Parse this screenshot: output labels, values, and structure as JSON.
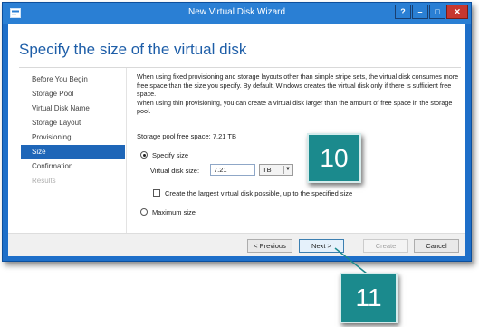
{
  "window": {
    "title": "New Virtual Disk Wizard",
    "controls": {
      "help": "?",
      "minimize": "–",
      "maximize": "□",
      "close": "✕"
    }
  },
  "page_title": "Specify the size of the virtual disk",
  "nav": {
    "items": [
      {
        "label": "Before You Begin",
        "state": "normal"
      },
      {
        "label": "Storage Pool",
        "state": "normal"
      },
      {
        "label": "Virtual Disk Name",
        "state": "normal"
      },
      {
        "label": "Storage Layout",
        "state": "normal"
      },
      {
        "label": "Provisioning",
        "state": "normal"
      },
      {
        "label": "Size",
        "state": "selected"
      },
      {
        "label": "Confirmation",
        "state": "normal"
      },
      {
        "label": "Results",
        "state": "disabled"
      }
    ]
  },
  "content": {
    "description_1": "When using fixed provisioning and storage layouts other than simple stripe sets, the virtual disk consumes more free space than the size you specify. By default, Windows creates the virtual disk only if there is sufficient free space.",
    "description_2": "When using thin provisioning, you can create a virtual disk larger than the amount of free space in the storage pool.",
    "pool_free_space_label": "Storage pool free space:",
    "pool_free_space_value": "7.21 TB",
    "specify_size_label": "Specify size",
    "virtual_disk_size_label": "Virtual disk size:",
    "virtual_disk_size_value": "7.21",
    "unit_selected": "TB",
    "create_largest_label": "Create the largest virtual disk possible, up to the specified size",
    "maximum_size_label": "Maximum size",
    "specify_size_checked": true,
    "maximum_size_checked": false,
    "create_largest_checked": false
  },
  "buttons": {
    "previous": "< Previous",
    "next": "Next >",
    "create": "Create",
    "cancel": "Cancel"
  },
  "callouts": {
    "step_10": "10",
    "step_11": "11"
  },
  "colors": {
    "title_bar": "#2a7fd4",
    "page_title": "#1e5ea8",
    "nav_selected": "#1e66b8",
    "callout": "#1b8a8d"
  }
}
